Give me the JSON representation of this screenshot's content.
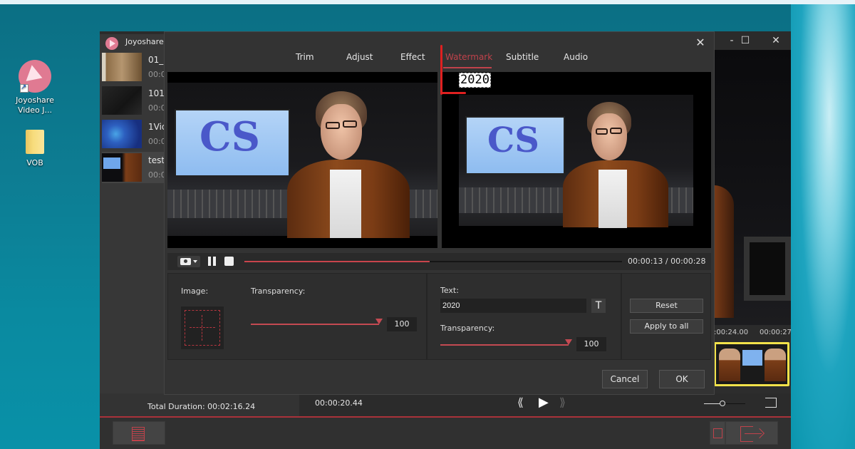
{
  "desktop": {
    "icons": [
      {
        "label": "Joyoshare Video J...",
        "icon": "joyoshare-app-icon"
      },
      {
        "label": "VOB",
        "icon": "folder-icon"
      }
    ]
  },
  "main_window": {
    "title": "Joyoshare",
    "controls": {
      "minimize": "-",
      "maximize": "☐",
      "close": "✕"
    },
    "files": [
      {
        "name": "01_",
        "duration": "00:0",
        "thumb_color": "#8a6a44"
      },
      {
        "name": "101_",
        "duration": "00:0",
        "thumb_color": "#1d1d1d"
      },
      {
        "name": "1Vid",
        "duration": "00:0",
        "thumb_color": "#1b3f95"
      },
      {
        "name": "test",
        "duration": "00:0",
        "thumb_color": "#2a2a2a"
      }
    ],
    "timeline": {
      "ticks": [
        ":00:24.00",
        "00:00:27"
      ]
    },
    "total_duration": "Total Duration: 00:02:16.24",
    "current_time": "00:00:20.44",
    "playback": {
      "prev": "⟪",
      "play": "▶",
      "next": "⟫"
    },
    "colors": {
      "accent": "#c0424b",
      "clip_border": "#f2e24a"
    }
  },
  "dialog": {
    "close": "✕",
    "tabs": [
      {
        "label": "Trim",
        "active": false
      },
      {
        "label": "Adjust",
        "active": false
      },
      {
        "label": "Effect",
        "active": false
      },
      {
        "label": "Watermark",
        "active": true
      },
      {
        "label": "Subtitle",
        "active": false
      },
      {
        "label": "Audio",
        "active": false
      }
    ],
    "preview": {
      "watermark_text": "2020",
      "screen_logo": "CS",
      "time_display": "00:00:13 / 00:00:28",
      "progress": 0.49
    },
    "image_section": {
      "image_label": "Image:",
      "transparency_label": "Transparency:",
      "transparency_value": "100",
      "transparency_fraction": 1.0
    },
    "text_section": {
      "text_label": "Text:",
      "text_value": "2020",
      "font_button": "T",
      "transparency_label": "Transparency:",
      "transparency_value": "100",
      "transparency_fraction": 1.0
    },
    "buttons": {
      "reset": "Reset",
      "apply_all": "Apply to all",
      "cancel": "Cancel",
      "ok": "OK"
    }
  }
}
